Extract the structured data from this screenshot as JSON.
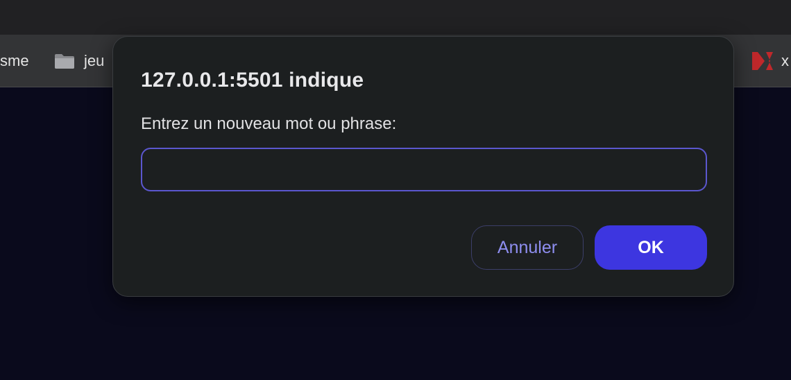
{
  "browser": {
    "bookmarks": [
      {
        "label": "sme"
      },
      {
        "label": "jeu"
      },
      {
        "label": "x"
      }
    ]
  },
  "dialog": {
    "title": "127.0.0.1:5501 indique",
    "message": "Entrez un nouveau mot ou phrase:",
    "input_value": "",
    "cancel_label": "Annuler",
    "ok_label": "OK"
  },
  "colors": {
    "page_background": "#0a0a1c",
    "dialog_background": "#1c1f20",
    "accent": "#3d36e0",
    "input_focus_border": "#5b57cf",
    "cancel_text": "#8e8ef0"
  }
}
